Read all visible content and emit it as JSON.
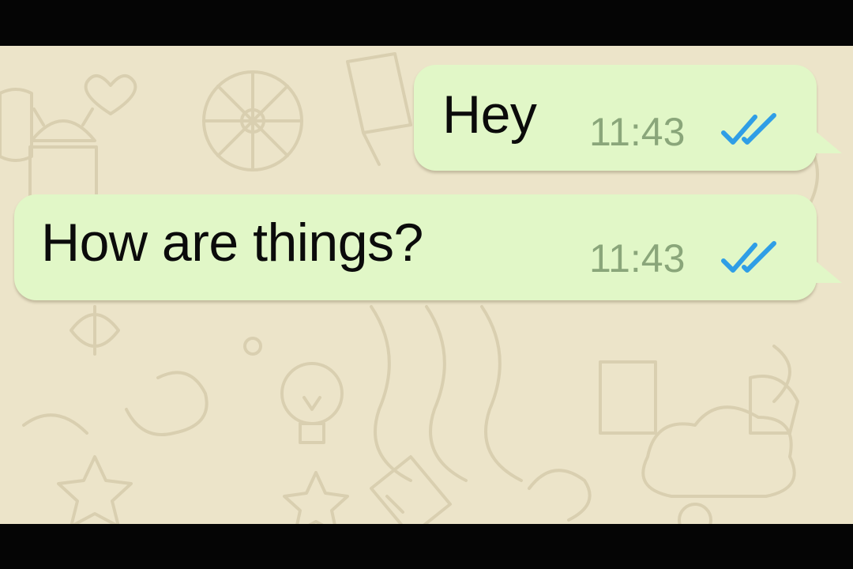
{
  "chat": {
    "messages": [
      {
        "text": "Hey",
        "time": "11:43",
        "status_icon": "double-check-read-icon"
      },
      {
        "text": "How are things?",
        "time": "11:43",
        "status_icon": "double-check-read-icon"
      }
    ]
  },
  "colors": {
    "background": "#ece4c9",
    "outgoing_bubble": "#e1f7c7",
    "timestamp": "#8aa67a",
    "read_ticks": "#2f9ee6"
  }
}
